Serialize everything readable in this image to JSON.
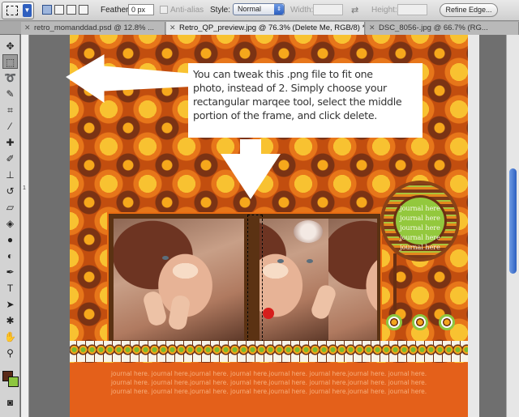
{
  "options_bar": {
    "feather_label": "Feather:",
    "feather_value": "0 px",
    "anti_alias_label": "Anti-alias",
    "style_label": "Style:",
    "style_value": "Normal",
    "width_label": "Width:",
    "height_label": "Height:",
    "refine_edge_label": "Refine Edge..."
  },
  "tabs": [
    {
      "label": "retro_momanddad.psd @ 12.8% ..."
    },
    {
      "label": "Retro_QP_preview.jpg @ 76.3% (Delete Me, RGB/8) *"
    },
    {
      "label": "DSC_8056-.jpg @ 66.7% (RG..."
    }
  ],
  "ruler": {
    "mark": "1"
  },
  "callout": {
    "lines": [
      "You can tweak this .png file to fit one",
      "photo, instead of 2. Simply choose your",
      "rectangular marqee tool, select the middle",
      "portion of the frame, and click delete."
    ]
  },
  "badge": {
    "lines": [
      "journal here",
      "journal here",
      "journal here",
      "journal here",
      "journal here"
    ]
  },
  "journal": {
    "lines": [
      "journal here. journal here.journal here. journal here.journal here. journal here.journal here. journal here.",
      "journal here. journal here.journal here. journal here.journal here. journal here.journal here. journal here.",
      "journal here. journal here.journal here. journal here.journal here. journal here.journal here. journal here."
    ]
  },
  "colors": {
    "foreground": "#5a2a18",
    "background": "#8dc63f",
    "accent": "#e4601a"
  },
  "icons": [
    "move-icon",
    "marquee-icon",
    "lasso-icon",
    "quick-select-icon",
    "crop-icon",
    "eyedropper-icon",
    "healing-icon",
    "brush-icon",
    "clone-stamp-icon",
    "history-brush-icon",
    "eraser-icon",
    "paint-bucket-icon",
    "blur-icon",
    "dodge-icon",
    "pen-icon",
    "type-icon",
    "path-select-icon",
    "shape-icon",
    "hand-icon",
    "zoom-icon"
  ]
}
